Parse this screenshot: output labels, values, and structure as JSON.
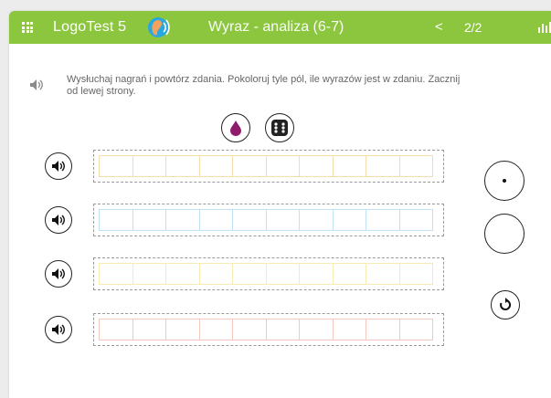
{
  "topbar": {
    "app_title": "LogoTest 5",
    "module_title": "Wyraz - analiza (6-7)",
    "prev_label": "<",
    "page_indicator": "2/2",
    "menu_icon": "grid-menu-icon",
    "module_icon": "ear-icon",
    "stats_icon": "bar-chart-icon"
  },
  "instruction": {
    "text": "Wysłuchaj nagrań i powtórz zdania. Pokoloruj tyle pól, ile wyrazów jest w zdaniu. Zacznij od lewej strony.",
    "icon": "speaker-icon"
  },
  "tools": [
    {
      "name": "paint-drop-icon",
      "color": "#8e1b6b"
    },
    {
      "name": "dice-icon"
    }
  ],
  "rows": [
    {
      "cells": 10,
      "cell_color": "#f7dcae",
      "speaker_icon": "speaker-icon"
    },
    {
      "cells": 10,
      "cell_color": "#bfe2f5",
      "speaker_icon": "speaker-icon"
    },
    {
      "cells": 10,
      "cell_color": "#f5ebb3",
      "speaker_icon": "speaker-icon"
    },
    {
      "cells": 10,
      "cell_color": "#f5c9bf",
      "speaker_icon": "speaker-icon"
    }
  ],
  "side_controls": [
    {
      "name": "dot-circle-button",
      "filled": true
    },
    {
      "name": "empty-circle-button",
      "filled": false
    },
    {
      "name": "reset-icon"
    }
  ],
  "colors": {
    "topbar": "#8cc63f",
    "background": "#ffffff",
    "dashed_border": "#9a9a9a"
  }
}
